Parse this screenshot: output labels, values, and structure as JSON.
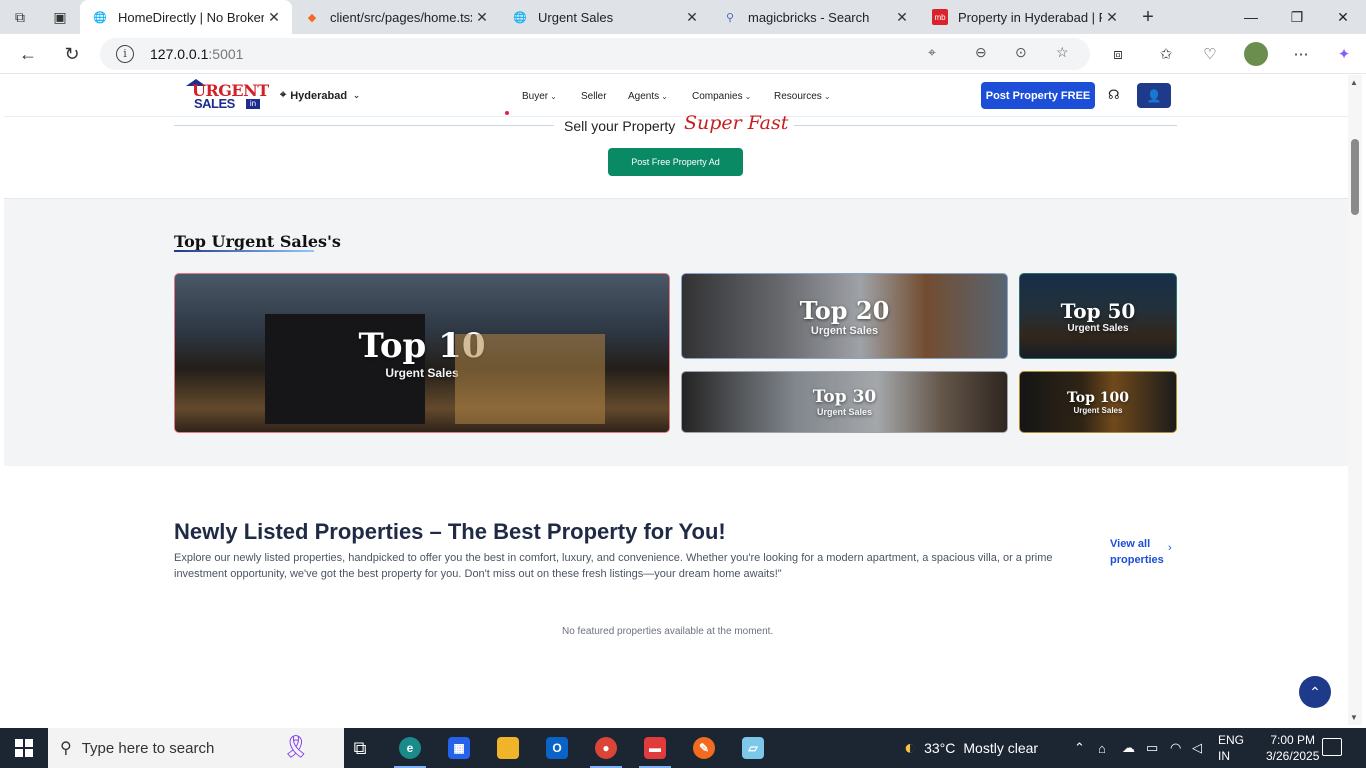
{
  "browser": {
    "tabs": [
      {
        "label": "HomeDirectly | No Broker Re",
        "icon": "globe-icon"
      },
      {
        "label": "client/src/pages/home.tsx - ",
        "icon": "vscode-icon"
      },
      {
        "label": "Urgent Sales",
        "icon": "globe-icon"
      },
      {
        "label": "magicbricks - Search",
        "icon": "search-icon"
      },
      {
        "label": "Property in Hyderabad | Rea",
        "icon": "mb-icon"
      }
    ],
    "url_host": "127.0.0.1",
    "url_port": ":5001",
    "mb_badge": "mb"
  },
  "site": {
    "logo": {
      "line1": "URGENT",
      "line2": "SALES",
      "badge": "in"
    },
    "city": "Hyderabad",
    "nav": [
      "Buyer",
      "Seller",
      "Agents",
      "Companies",
      "Resources"
    ],
    "post_button": "Post Property FREE"
  },
  "sell": {
    "text": "Sell your Property",
    "highlight": "Super Fast",
    "button": "Post Free Property Ad"
  },
  "top_sales": {
    "title": "Top Urgent Sales's",
    "cards": [
      {
        "title": "Top 10",
        "subtitle": "Urgent Sales"
      },
      {
        "title": "Top 20",
        "subtitle": "Urgent Sales"
      },
      {
        "title": "Top 50",
        "subtitle": "Urgent Sales"
      },
      {
        "title": "Top 30",
        "subtitle": "Urgent Sales"
      },
      {
        "title": "Top 100",
        "subtitle": "Urgent Sales"
      }
    ]
  },
  "newly_listed": {
    "title": "Newly Listed Properties – The Best Property for You!",
    "description": "Explore our newly listed properties, handpicked to offer you the best in comfort, luxury, and convenience. Whether you're looking for a modern apartment, a spacious villa, or a prime investment opportunity, we've got the best property for you. Don't miss out on these fresh listings—your dream home awaits!\"",
    "view_all": "View all properties",
    "empty_message": "No featured properties available at the moment."
  },
  "taskbar": {
    "search_placeholder": "Type here to search",
    "weather_temp": "33°C",
    "weather_desc": "Mostly clear",
    "lang_line1": "ENG",
    "lang_line2": "IN",
    "time": "7:00 PM",
    "date": "3/26/2025"
  }
}
